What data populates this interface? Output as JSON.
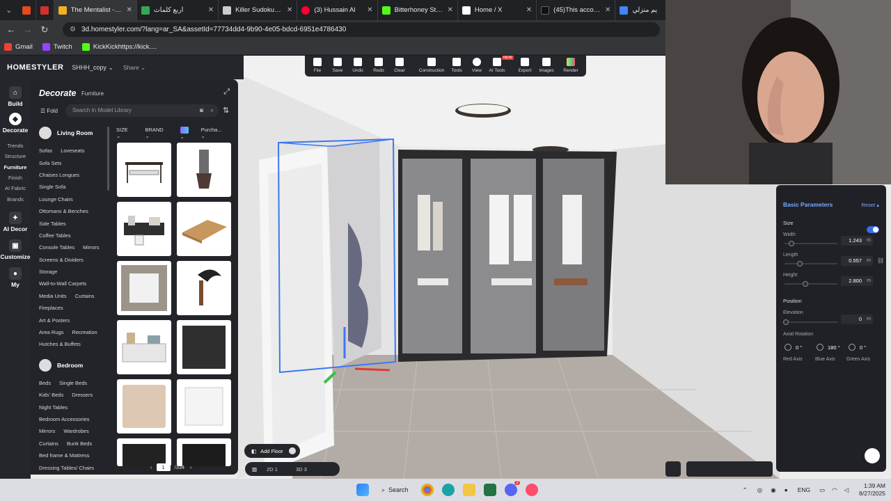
{
  "browser": {
    "tabs": [
      {
        "title": "",
        "color": "#e64a19"
      },
      {
        "title": "",
        "color": "#d32f2f"
      },
      {
        "title": "The Mentalist - S4",
        "color": "#f2b21e"
      },
      {
        "title": "أربع كلمات",
        "color": "#34a853"
      },
      {
        "title": "Killer Sudoku ألغاز",
        "color": "#cccccc"
      },
      {
        "title": "(3) Hussain Al",
        "color": "#ff0033"
      },
      {
        "title": "Bitterhoney Stream",
        "color": "#53fc18"
      },
      {
        "title": "Home / X",
        "color": "#ffffff"
      },
      {
        "title": "(45)This account is",
        "color": "#111111"
      },
      {
        "title": "يم منزلي",
        "color": "#4285f4"
      }
    ],
    "url": "3d.homestyler.com/?lang=ar_SA&assetId=77734dd4-9b90-4e05-bdcd-6951e4786430",
    "bookmarks": [
      {
        "label": "Gmail",
        "color": "#ea4335"
      },
      {
        "label": "Twitch",
        "color": "#9146ff"
      },
      {
        "label": "KickKickhttps://kick....",
        "color": "#53fc18"
      }
    ]
  },
  "app": {
    "logo": "HOMESTYLER",
    "project": "SHHH_copy",
    "share": "Share",
    "toolbar": [
      {
        "label": "File"
      },
      {
        "label": "Save"
      },
      {
        "label": "Undo"
      },
      {
        "label": "Redo"
      },
      {
        "label": "Clear"
      },
      {
        "label": "Construction"
      },
      {
        "label": "Tools"
      },
      {
        "label": "View"
      },
      {
        "label": "AI Tools"
      },
      {
        "label": "Export"
      },
      {
        "label": "Images"
      },
      {
        "label": "Render"
      }
    ],
    "new_badge": "NEW",
    "rail": {
      "build": "Build",
      "decorate": "Decorate",
      "trends": "Trends",
      "structure": "Structure",
      "furniture": "Furniture",
      "finish": "Finish",
      "ai_fabric": "AI Fabric",
      "brands": "Brands",
      "ai_decor": "AI Decor",
      "customize": "Customize",
      "my": "My"
    },
    "panel": {
      "title": "Decorate",
      "subtitle": "Furniture",
      "fold": "Fold",
      "search_placeholder": "Search In Model Library",
      "filters": {
        "size": "SIZE",
        "brand": "BRAND",
        "purchase": "Purcha..."
      },
      "living_room": "Living Room",
      "living_rows": [
        [
          "Sofas",
          "Loveseats"
        ],
        [
          "Sofa Sets"
        ],
        [
          "Chaises Longues"
        ],
        [
          "Single Sofa"
        ],
        [
          "Lounge Chairs"
        ],
        [
          "Ottomans & Benches"
        ],
        [
          "Side Tables"
        ],
        [
          "Coffee Tables"
        ],
        [
          "Console Tables",
          "Mirrors"
        ],
        [
          "Screens & Dividers"
        ],
        [
          "Storage"
        ],
        [
          "Wall-to-Wall Carpets"
        ],
        [
          "Media Units",
          "Curtains"
        ],
        [
          "Fireplaces"
        ],
        [
          "Art & Posters"
        ],
        [
          "Area Rugs",
          "Recreation"
        ],
        [
          "Hutches & Buffets"
        ]
      ],
      "bedroom": "Bedroom",
      "bedroom_rows": [
        [
          "Beds",
          "Single Beds"
        ],
        [
          "Kids' Beds",
          "Dressers"
        ],
        [
          "Night Tables"
        ],
        [
          "Bedroom Accessories"
        ],
        [
          "Mirrors",
          "Wardrobes"
        ],
        [
          "Curtains",
          "Bunk Beds"
        ],
        [
          "Bed frame & Mattress"
        ],
        [
          "Dressing Tables/ Chairs"
        ]
      ],
      "page_current": "1",
      "page_total": "/334"
    },
    "add_floor": "Add Floor",
    "view_2d": "2D 1",
    "view_3d": "3D 3",
    "props": {
      "basic_parameters": "Basic Parameters",
      "reset": "Reset",
      "size": "Size",
      "width_label": "Width",
      "width": "1.243",
      "length_label": "Length",
      "length": "0.557",
      "height_label": "Height",
      "height": "2.800",
      "unit": "m",
      "position": "Position",
      "elevation_label": "Elevation",
      "elevation": "0",
      "axial_rotation": "Axial Rotation",
      "red_val": "0",
      "blue_val": "180",
      "green_val": "0",
      "deg": "°",
      "red_axis": "Red Axis",
      "blue_axis": "Blue Axis",
      "green_axis": "Green Axis"
    }
  },
  "taskbar": {
    "search": "Search",
    "lang": "ENG",
    "time": "1:39 AM",
    "date": "8/27/2025",
    "discord_badge": "3"
  }
}
